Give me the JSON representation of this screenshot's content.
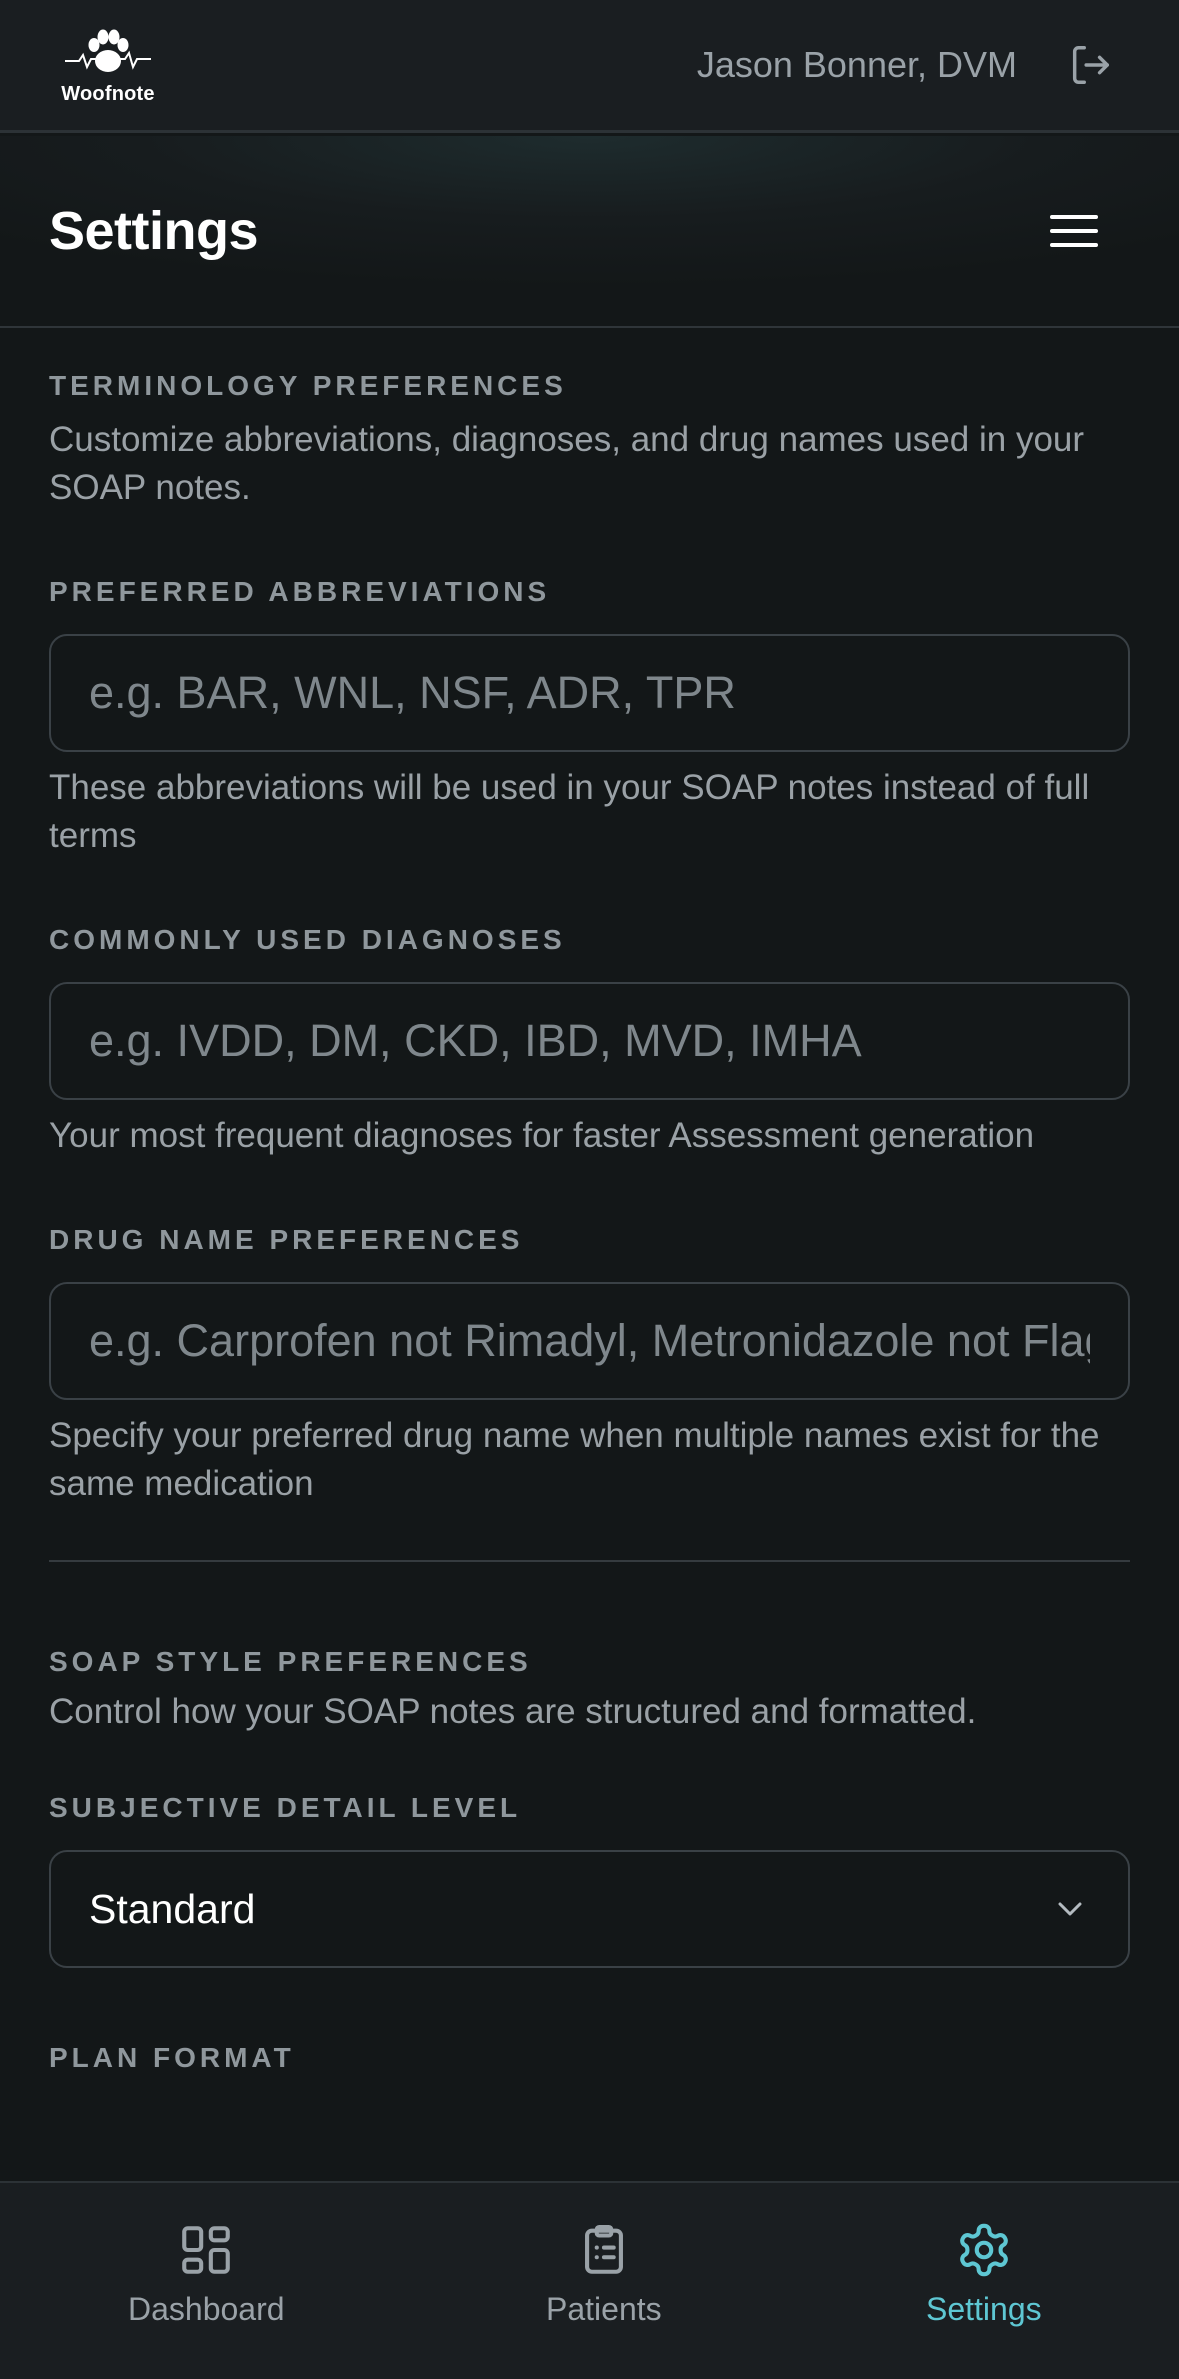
{
  "topbar": {
    "logo_text": "Woofnote",
    "user_name": "Jason Bonner, DVM"
  },
  "header": {
    "title": "Settings"
  },
  "terminology": {
    "title": "TERMINOLOGY PREFERENCES",
    "description": "Customize abbreviations, diagnoses, and drug names used in your SOAP notes.",
    "abbreviations": {
      "label": "PREFERRED ABBREVIATIONS",
      "value": "",
      "placeholder": "e.g. BAR, WNL, NSF, ADR, TPR",
      "helper": "These abbreviations will be used in your SOAP notes instead of full terms"
    },
    "diagnoses": {
      "label": "COMMONLY USED DIAGNOSES",
      "value": "",
      "placeholder": "e.g. IVDD, DM, CKD, IBD, MVD, IMHA",
      "helper": "Your most frequent diagnoses for faster Assessment generation"
    },
    "drugs": {
      "label": "DRUG NAME PREFERENCES",
      "value": "",
      "placeholder": "e.g. Carprofen not Rimadyl, Metronidazole not Flagyl",
      "helper": "Specify your preferred drug name when multiple names exist for the same medication"
    }
  },
  "soap_style": {
    "title": "SOAP STYLE PREFERENCES",
    "description": "Control how your SOAP notes are structured and formatted.",
    "subjective": {
      "label": "SUBJECTIVE DETAIL LEVEL",
      "selected": "Standard"
    },
    "plan": {
      "label": "PLAN FORMAT"
    }
  },
  "bottom_nav": {
    "items": [
      {
        "label": "Dashboard",
        "icon": "dashboard-grid-icon",
        "active": false
      },
      {
        "label": "Patients",
        "icon": "clipboard-list-icon",
        "active": false
      },
      {
        "label": "Settings",
        "icon": "gear-icon",
        "active": true
      }
    ]
  },
  "colors": {
    "background": "#131718",
    "bar": "#1a1e21",
    "accent": "#5ec7d3",
    "muted_text": "#9aa1a6"
  }
}
